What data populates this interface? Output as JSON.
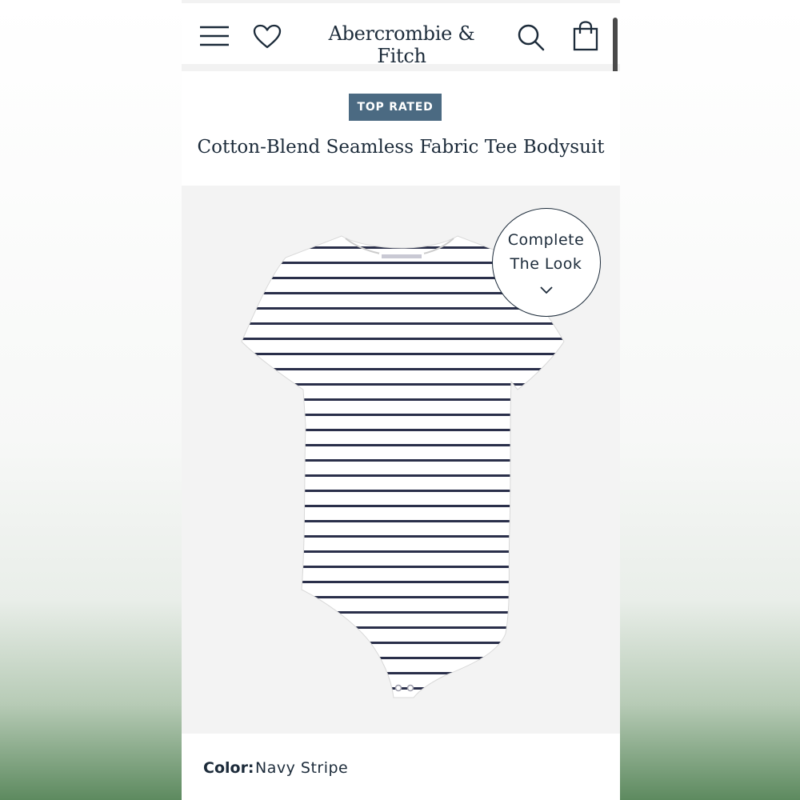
{
  "header": {
    "brand": "Abercrombie & Fitch",
    "icons": [
      "menu-icon",
      "heart-icon",
      "search-icon",
      "shopping-bag-icon"
    ]
  },
  "product": {
    "badge": "TOP RATED",
    "title": "Cotton-Blend Seamless Fabric Tee Bodysuit",
    "image_alt": "White short-sleeve bodysuit with navy horizontal stripes"
  },
  "complete_the_look": {
    "line1": "Complete",
    "line2": "The Look"
  },
  "color": {
    "label": "Color:",
    "value": "Navy Stripe"
  },
  "colors": {
    "text_navy": "#1c2b3a",
    "badge_bg": "#4b6a82",
    "stripe": "#2a2f4a"
  }
}
